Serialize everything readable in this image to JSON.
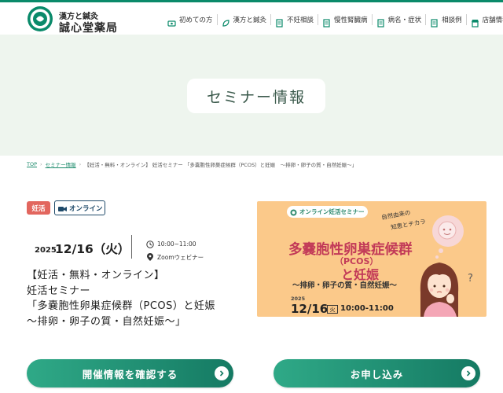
{
  "colors": {
    "brand_green": "#0a8a6a",
    "hero_bg": "#eef5ee",
    "tag_red": "#e2665e",
    "tag_navy": "#1f4a6a",
    "banner_bg": "#fbc98a",
    "banner_title": "#c23a58",
    "button_gradient_start": "#2fa987",
    "button_gradient_end": "#157a63"
  },
  "header": {
    "logo_icon": "circle-emblem-icon",
    "brand_sub": "漢方と鍼灸",
    "brand_main": "誠心堂薬局",
    "nav": [
      {
        "label": "初めての方",
        "icon": "welcome-icon"
      },
      {
        "label": "漢方と鍼灸",
        "icon": "leaf-icon"
      },
      {
        "label": "不妊相談",
        "icon": "document-icon"
      },
      {
        "label": "慢性腎臓病",
        "icon": "document-icon"
      },
      {
        "label": "病名・症状",
        "icon": "document-icon"
      },
      {
        "label": "相談例",
        "icon": "document-icon"
      },
      {
        "label": "店舗情報",
        "icon": "store-icon"
      }
    ]
  },
  "hero": {
    "title": "セミナー情報"
  },
  "breadcrumb": {
    "top": "TOP",
    "seminar": "セミナー情報",
    "current": "【妊活・無料・オンライン】 妊活セミナー 「多嚢胞性卵巣症候群（PCOS）と妊娠　～排卵・卵子の質・自然妊娠～」"
  },
  "tags": {
    "category": "妊活",
    "format": "オンライン",
    "format_icon": "video-camera-icon"
  },
  "event": {
    "year": "2025",
    "date": "12/16（火）",
    "time": "10:00~11:00",
    "place": "Zoomウェビナー",
    "title_lines": [
      "【妊活・無料・オンライン】",
      "妊活セミナー",
      "「多嚢胞性卵巣症候群（PCOS）と妊娠",
      "～排卵・卵子の質・自然妊娠～」"
    ]
  },
  "banner": {
    "pill": "オンライン妊活セミナー",
    "tagline_1": "自然由来の",
    "tagline_2": "知恵とチカラ",
    "title_1": "多嚢胞性卵巣症候群",
    "title_2": "（PCOS）",
    "title_3": "と妊娠",
    "subtitle": "～排卵・卵子の質・自然妊娠～",
    "year": "2025",
    "date": "12/16",
    "day": "火",
    "time": "10:00-11:00"
  },
  "buttons": {
    "info": "開催情報を確認する",
    "apply": "お申し込み"
  }
}
